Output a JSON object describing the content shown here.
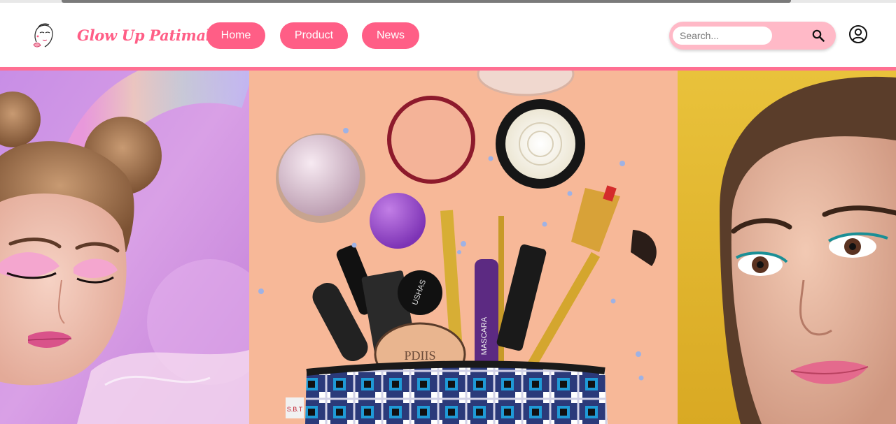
{
  "header": {
    "brand": "Glow Up Patimah",
    "logo_icon": "makeup-face-logo-icon",
    "nav": {
      "home": "Home",
      "product": "Product",
      "news": "News"
    },
    "search": {
      "placeholder": "Search...",
      "value": "",
      "icon": "search-icon"
    },
    "user_icon": "user-account-icon"
  },
  "colors": {
    "accent": "#ff5e86",
    "search_background": "#ffb9c7",
    "divider": "#ff6f92"
  },
  "hero": {
    "panels": [
      {
        "image": "woman-with-pink-eye-makeup-on-pastel-rainbow-background"
      },
      {
        "image": "makeup-products-spilling-from-pouch-on-peach-background"
      },
      {
        "image": "woman-with-teal-eyeliner-on-yellow-background"
      }
    ]
  }
}
